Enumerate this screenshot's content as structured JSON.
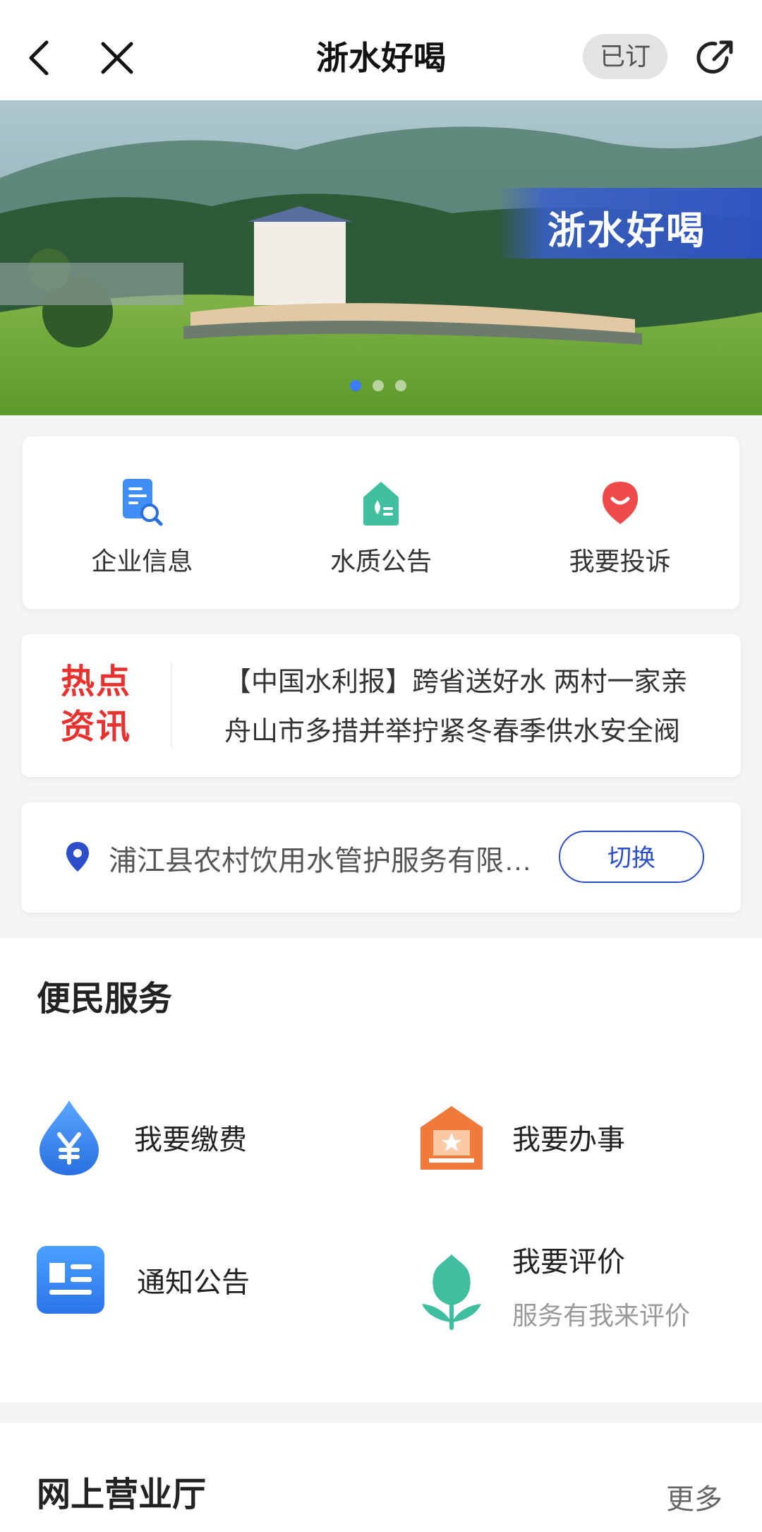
{
  "header": {
    "title": "浙水好喝",
    "subscribed_label": "已订"
  },
  "banner": {
    "overlay_text": "浙水好喝",
    "page_count": 3,
    "active_page": 1
  },
  "quick_actions": [
    {
      "label": "企业信息",
      "icon": "document-search-icon"
    },
    {
      "label": "水质公告",
      "icon": "water-quality-icon"
    },
    {
      "label": "我要投诉",
      "icon": "complaint-icon"
    }
  ],
  "news": {
    "badge_line1": "热点",
    "badge_line2": "资讯",
    "items": [
      "【中国水利报】跨省送好水 两村一家亲",
      "舟山市多措并举拧紧冬春季供水安全阀"
    ]
  },
  "location": {
    "name": "浦江县农村饮用水管护服务有限公司",
    "switch_label": "切换"
  },
  "services": {
    "title": "便民服务",
    "items": [
      {
        "label": "我要缴费",
        "icon": "payment-drop-icon"
      },
      {
        "label": "我要办事",
        "icon": "office-building-icon"
      },
      {
        "label": "通知公告",
        "icon": "notice-icon"
      },
      {
        "label": "我要评价",
        "sub": "服务有我来评价",
        "icon": "tulip-icon"
      }
    ]
  },
  "online_hall": {
    "title": "网上营业厅",
    "more_label": "更多"
  },
  "colors": {
    "accent_blue": "#2c4fc9",
    "hot_red": "#e8322f",
    "teal": "#3fbf9f",
    "orange": "#f07a3a"
  }
}
